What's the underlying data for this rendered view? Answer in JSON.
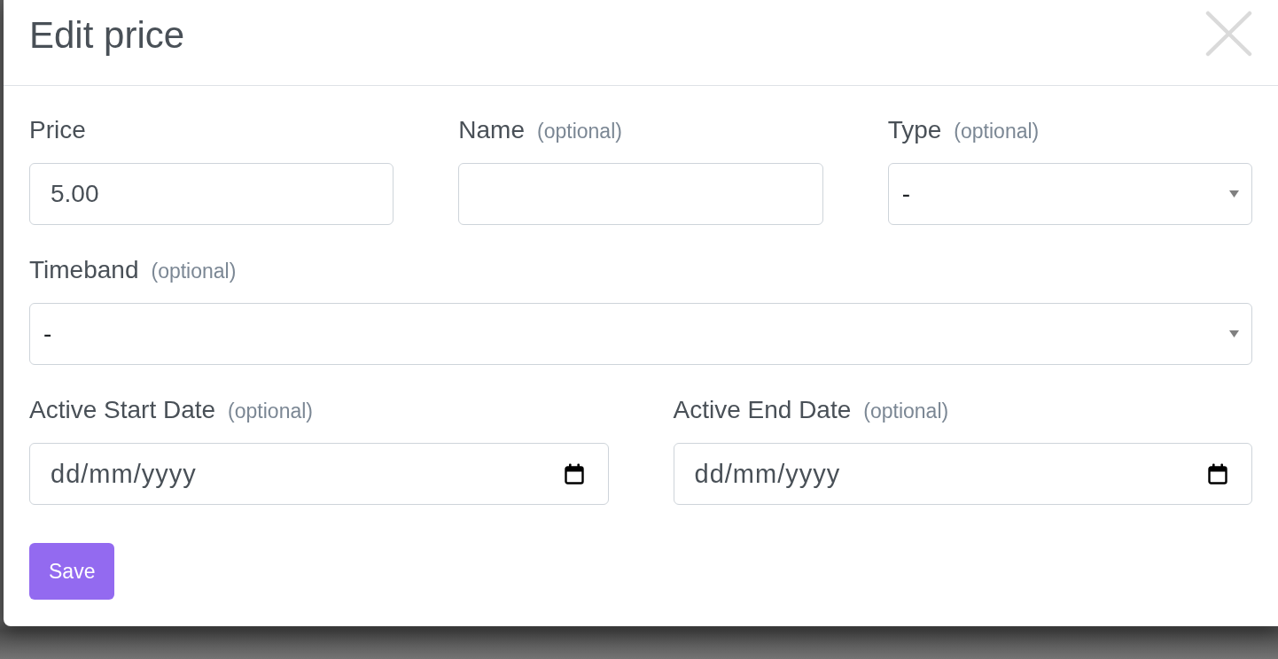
{
  "dialog": {
    "title": "Edit price",
    "rows": [
      {
        "fields": [
          {
            "kind": "text",
            "label": "Price",
            "value": "5.00"
          },
          {
            "kind": "text",
            "label": "Name",
            "note": "(optional)"
          },
          {
            "kind": "select",
            "label": "Type",
            "note": "(optional)",
            "value": "-"
          }
        ]
      },
      {
        "fields": [
          {
            "kind": "select",
            "label": "Timeband",
            "note": "(optional)",
            "value": "-"
          }
        ]
      },
      {
        "fields": [
          {
            "kind": "date",
            "label": "Active Start Date",
            "note": "(optional)",
            "placeholder": "dd/mm/yyyy"
          },
          {
            "kind": "date",
            "label": "Active End Date",
            "note": "(optional)",
            "placeholder": "dd/mm/yyyy"
          }
        ]
      }
    ],
    "save_button": "Save"
  }
}
